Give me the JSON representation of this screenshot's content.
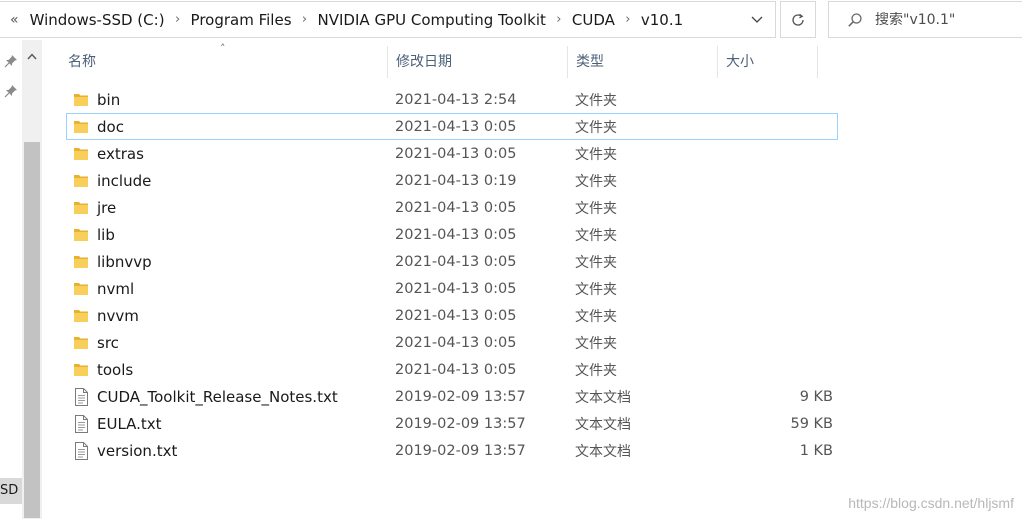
{
  "address_bar": {
    "overflow_label": "«",
    "crumbs": [
      "Windows-SSD (C:)",
      "Program Files",
      "NVIDIA GPU Computing Toolkit",
      "CUDA",
      "v10.1"
    ]
  },
  "search": {
    "placeholder": "搜索\"v10.1\""
  },
  "columns": {
    "name": "名称",
    "date": "修改日期",
    "type": "类型",
    "size": "大小"
  },
  "nav": {
    "drive_fragment": "SD ("
  },
  "files": [
    {
      "name": "bin",
      "date": "2021-04-13 2:54",
      "type": "文件夹",
      "size": "",
      "kind": "folder"
    },
    {
      "name": "doc",
      "date": "2021-04-13 0:05",
      "type": "文件夹",
      "size": "",
      "kind": "folder"
    },
    {
      "name": "extras",
      "date": "2021-04-13 0:05",
      "type": "文件夹",
      "size": "",
      "kind": "folder"
    },
    {
      "name": "include",
      "date": "2021-04-13 0:19",
      "type": "文件夹",
      "size": "",
      "kind": "folder"
    },
    {
      "name": "jre",
      "date": "2021-04-13 0:05",
      "type": "文件夹",
      "size": "",
      "kind": "folder"
    },
    {
      "name": "lib",
      "date": "2021-04-13 0:05",
      "type": "文件夹",
      "size": "",
      "kind": "folder"
    },
    {
      "name": "libnvvp",
      "date": "2021-04-13 0:05",
      "type": "文件夹",
      "size": "",
      "kind": "folder"
    },
    {
      "name": "nvml",
      "date": "2021-04-13 0:05",
      "type": "文件夹",
      "size": "",
      "kind": "folder"
    },
    {
      "name": "nvvm",
      "date": "2021-04-13 0:05",
      "type": "文件夹",
      "size": "",
      "kind": "folder"
    },
    {
      "name": "src",
      "date": "2021-04-13 0:05",
      "type": "文件夹",
      "size": "",
      "kind": "folder"
    },
    {
      "name": "tools",
      "date": "2021-04-13 0:05",
      "type": "文件夹",
      "size": "",
      "kind": "folder"
    },
    {
      "name": "CUDA_Toolkit_Release_Notes.txt",
      "date": "2019-02-09 13:57",
      "type": "文本文档",
      "size": "9 KB",
      "kind": "text"
    },
    {
      "name": "EULA.txt",
      "date": "2019-02-09 13:57",
      "type": "文本文档",
      "size": "59 KB",
      "kind": "text"
    },
    {
      "name": "version.txt",
      "date": "2019-02-09 13:57",
      "type": "文本文档",
      "size": "1 KB",
      "kind": "text"
    }
  ],
  "focused_item": "doc",
  "watermark": "https://blog.csdn.net/hljsmf",
  "colors": {
    "folder": "#f5c342",
    "focus_border": "#99d1ff",
    "header_text": "#4c607a"
  }
}
